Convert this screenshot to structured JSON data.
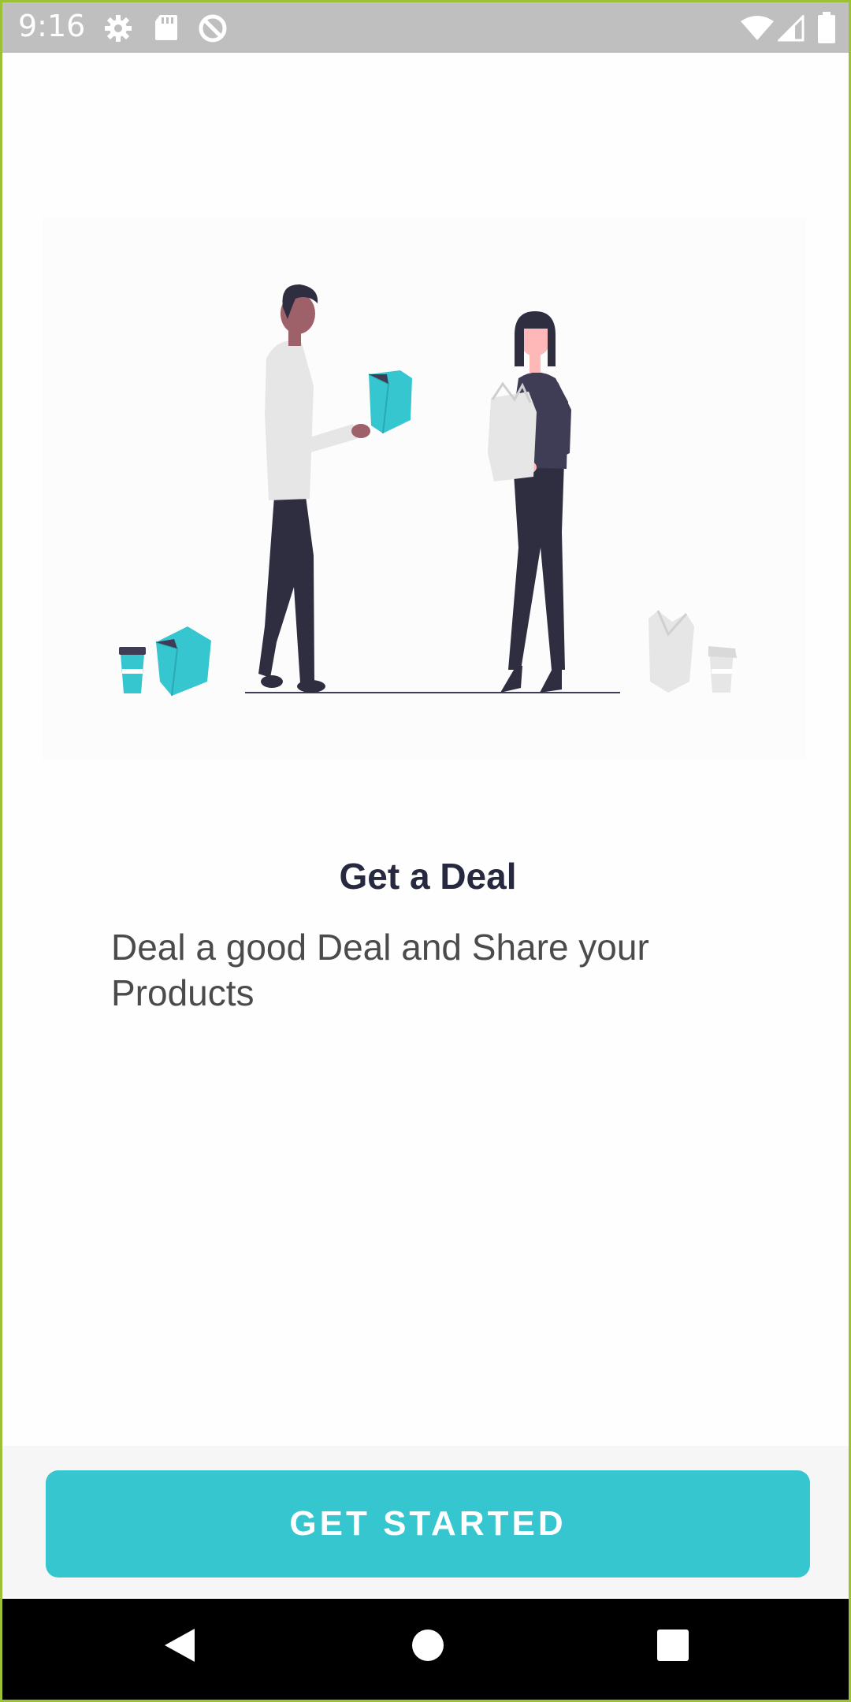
{
  "status_bar": {
    "time": "9:16",
    "left_icons": [
      "gear-icon",
      "sd-card-icon",
      "sync-disabled-icon"
    ],
    "right_icons": [
      "wifi-icon",
      "cell-signal-icon",
      "battery-icon"
    ]
  },
  "onboarding": {
    "title": "Get a Deal",
    "description": "Deal a good Deal and Share your Products"
  },
  "cta": {
    "label": "GET STARTED"
  },
  "nav": {
    "icons": [
      "back-icon",
      "home-icon",
      "recents-icon"
    ]
  },
  "colors": {
    "accent": "#35c6cf",
    "title": "#26293f",
    "description": "#4b4b4b",
    "status_bar": "#bfbfbf",
    "frame": "#9cc135"
  }
}
